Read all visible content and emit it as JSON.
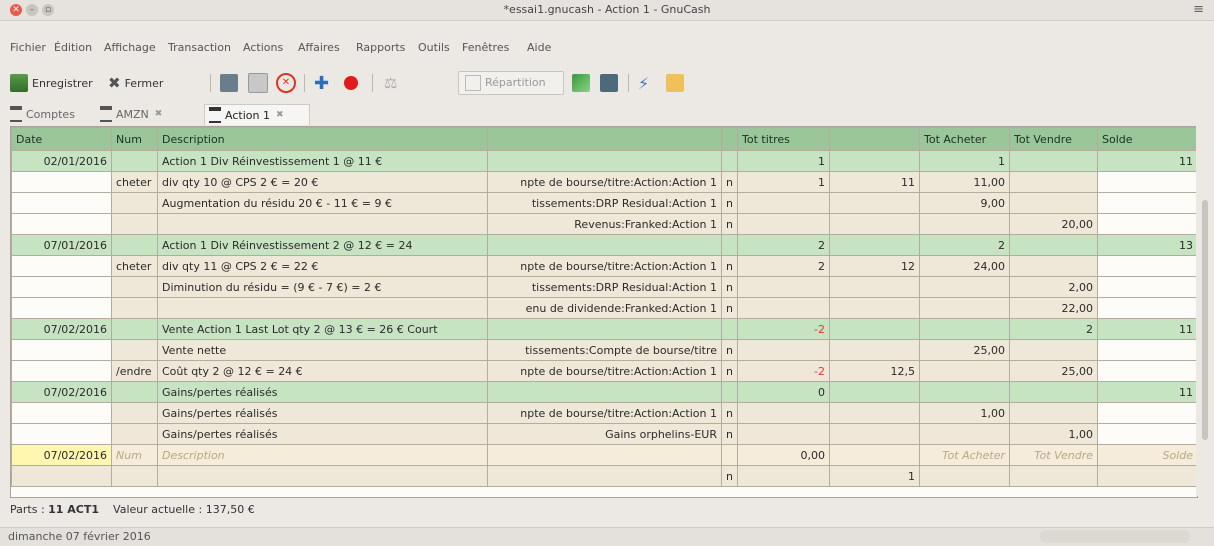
{
  "window": {
    "title": "*essai1.gnucash - Action 1 - GnuCash"
  },
  "menu": [
    "Fichier",
    "Édition",
    "Affichage",
    "Transaction",
    "Actions",
    "Affaires",
    "Rapports",
    "Outils",
    "Fenêtres",
    "Aide"
  ],
  "toolbar": {
    "save_label": "Enregistrer",
    "close_label": "Fermer",
    "split_label": "Répartition"
  },
  "tabs": [
    {
      "label": "Comptes"
    },
    {
      "label": "AMZN"
    },
    {
      "label": "Action 1"
    }
  ],
  "register": {
    "headers": [
      "Date",
      "Num",
      "Description",
      "",
      "",
      "Tot titres",
      "",
      "Tot Acheter",
      "Tot Vendre",
      "Solde"
    ],
    "rows": [
      {
        "kind": "trans",
        "date": "02/01/2016",
        "num": "",
        "desc": "Action 1 Div Réinvestissement 1 @ 11 €",
        "acct": "",
        "r": "",
        "titres": "1",
        "price": "",
        "acheter": "1",
        "vendre": "",
        "solde": "11"
      },
      {
        "kind": "split",
        "date": "",
        "num": "cheter",
        "desc": "div qty 10 @ CPS 2 € = 20 €",
        "acct": "npte de bourse/titre:Action:Action 1",
        "r": "n",
        "titres": "1",
        "price": "11",
        "acheter": "11,00",
        "vendre": "",
        "solde": ""
      },
      {
        "kind": "split",
        "date": "",
        "num": "",
        "desc": "Augmentation du résidu 20 € - 11 € = 9 €",
        "acct": "tissements:DRP Residual:Action 1",
        "r": "n",
        "titres": "",
        "price": "",
        "acheter": "9,00",
        "vendre": "",
        "solde": ""
      },
      {
        "kind": "split",
        "date": "",
        "num": "",
        "desc": "",
        "acct": "Revenus:Franked:Action 1",
        "r": "n",
        "titres": "",
        "price": "",
        "acheter": "",
        "vendre": "20,00",
        "solde": ""
      },
      {
        "kind": "trans",
        "date": "07/01/2016",
        "num": "",
        "desc": "Action 1 Div Réinvestissement 2 @ 12 € = 24",
        "acct": "",
        "r": "",
        "titres": "2",
        "price": "",
        "acheter": "2",
        "vendre": "",
        "solde": "13"
      },
      {
        "kind": "split",
        "date": "",
        "num": "cheter",
        "desc": "div qty 11 @ CPS 2 € = 22 €",
        "acct": "npte de bourse/titre:Action:Action 1",
        "r": "n",
        "titres": "2",
        "price": "12",
        "acheter": "24,00",
        "vendre": "",
        "solde": ""
      },
      {
        "kind": "split",
        "date": "",
        "num": "",
        "desc": "Diminution du résidu = (9 € - 7 €) = 2 €",
        "acct": "tissements:DRP Residual:Action 1",
        "r": "n",
        "titres": "",
        "price": "",
        "acheter": "",
        "vendre": "2,00",
        "solde": ""
      },
      {
        "kind": "split",
        "date": "",
        "num": "",
        "desc": "",
        "acct": "enu de dividende:Franked:Action 1",
        "r": "n",
        "titres": "",
        "price": "",
        "acheter": "",
        "vendre": "22,00",
        "solde": ""
      },
      {
        "kind": "trans",
        "date": "07/02/2016",
        "num": "",
        "desc": "Vente Action 1 Last Lot qty 2 @ 13 € = 26 € Court",
        "acct": "",
        "r": "",
        "titres": "-2",
        "price": "",
        "acheter": "",
        "vendre": "2",
        "solde": "11",
        "neg": true
      },
      {
        "kind": "split",
        "date": "",
        "num": "",
        "desc": "Vente nette",
        "acct": "tissements:Compte de bourse/titre",
        "r": "n",
        "titres": "",
        "price": "",
        "acheter": "25,00",
        "vendre": "",
        "solde": ""
      },
      {
        "kind": "split",
        "date": "",
        "num": "/endre",
        "desc": "Coût qty 2 @ 12 € = 24 €",
        "acct": "npte de bourse/titre:Action:Action 1",
        "r": "n",
        "titres": "-2",
        "price": "12,5",
        "acheter": "",
        "vendre": "25,00",
        "solde": "",
        "neg": true
      },
      {
        "kind": "trans",
        "date": "07/02/2016",
        "num": "",
        "desc": "Gains/pertes réalisés",
        "acct": "",
        "r": "",
        "titres": "0",
        "price": "",
        "acheter": "",
        "vendre": "",
        "solde": "11"
      },
      {
        "kind": "split",
        "date": "",
        "num": "",
        "desc": "Gains/pertes réalisés",
        "acct": "npte de bourse/titre:Action:Action 1",
        "r": "n",
        "titres": "",
        "price": "",
        "acheter": "1,00",
        "vendre": "",
        "solde": ""
      },
      {
        "kind": "split",
        "date": "",
        "num": "",
        "desc": "Gains/pertes réalisés",
        "acct": "Gains orphelins-EUR",
        "r": "n",
        "titres": "",
        "price": "",
        "acheter": "",
        "vendre": "1,00",
        "solde": ""
      }
    ],
    "blank_entry": {
      "date": "07/02/2016",
      "num_ph": "Num",
      "desc_ph": "Description",
      "titres": "0,00",
      "acheter_ph": "Tot Acheter",
      "vendre_ph": "Tot Vendre",
      "solde_ph": "Solde"
    },
    "blank_split": {
      "r": "n",
      "price": "1"
    }
  },
  "summary": {
    "parts_label": "Parts :",
    "parts_value": "11 ACT1",
    "value_label": "Valeur actuelle :",
    "value_value": "137,50 €"
  },
  "status": {
    "date_text": "dimanche 07 février 2016"
  },
  "colors": {
    "header": "#9ac69a",
    "transaction": "#c6e3c2",
    "split": "#efe8d8",
    "negative": "#e03b2a",
    "blank_date": "#fff6b0"
  }
}
